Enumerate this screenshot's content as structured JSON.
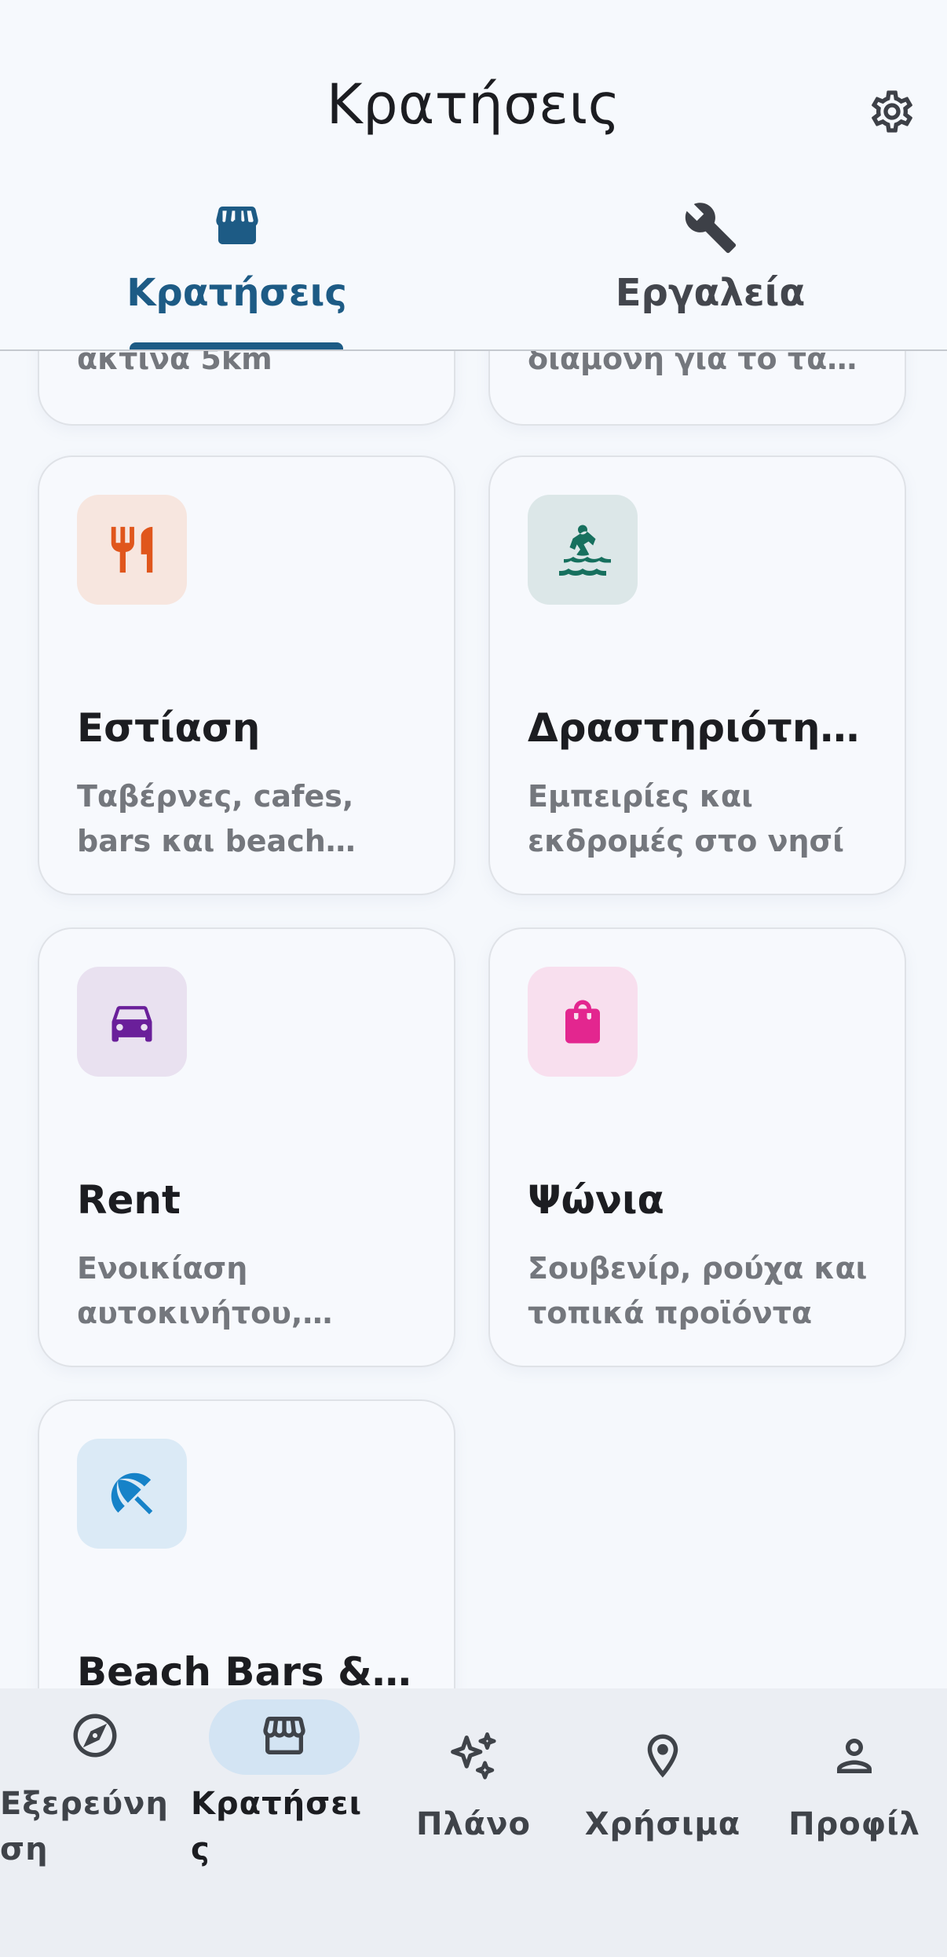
{
  "header": {
    "title": "Κρατήσεις",
    "settings_icon": "gear-icon"
  },
  "tabs": [
    {
      "label": "Κρατήσεις",
      "icon": "storefront-icon",
      "selected": true
    },
    {
      "label": "Εργαλεία",
      "icon": "wrench-icon",
      "selected": false
    }
  ],
  "partial_cards": [
    {
      "desc": "ακτίνα 5km"
    },
    {
      "desc": "διαμονή για το ταξίδι σας"
    }
  ],
  "cards": [
    {
      "title": "Εστίαση",
      "desc": "Ταβέρνες, cafes, bars και beach clubs",
      "icon": "restaurant-icon",
      "icon_color": "#e0561c",
      "icon_bg": "#f7e6df"
    },
    {
      "title": "Δραστηριότητες",
      "desc": "Εμπειρίες και εκδρομές στο νησί",
      "icon": "kayaking-icon",
      "icon_color": "#17705e",
      "icon_bg": "#dce7e8"
    },
    {
      "title": "Rent",
      "desc": "Ενοικίαση αυτοκινήτου, σκούτερ και ATV",
      "icon": "car-icon",
      "icon_color": "#6a1f9a",
      "icon_bg": "#e9e1f0"
    },
    {
      "title": "Ψώνια",
      "desc": "Σουβενίρ, ρούχα και τοπικά προϊόντα",
      "icon": "shopping-bag-icon",
      "icon_color": "#e3268f",
      "icon_bg": "#f8dfee"
    },
    {
      "title": "Beach Bars & Clubs",
      "desc": "",
      "icon": "beach-umbrella-icon",
      "icon_color": "#1682c8",
      "icon_bg": "#dbeaf6"
    }
  ],
  "bottom_nav": [
    {
      "label": "Εξερεύνηση",
      "icon": "compass-icon",
      "active": false
    },
    {
      "label": "Κρατήσεις",
      "icon": "storefront-icon",
      "active": true
    },
    {
      "label": "Πλάνο",
      "icon": "sparkles-icon",
      "active": false
    },
    {
      "label": "Χρήσιμα",
      "icon": "location-pin-icon",
      "active": false
    },
    {
      "label": "Προφίλ",
      "icon": "person-icon",
      "active": false
    }
  ],
  "colors": {
    "accent": "#1d5b85",
    "background": "#f5f8fc",
    "nav_active_pill": "#d3e4f3"
  }
}
